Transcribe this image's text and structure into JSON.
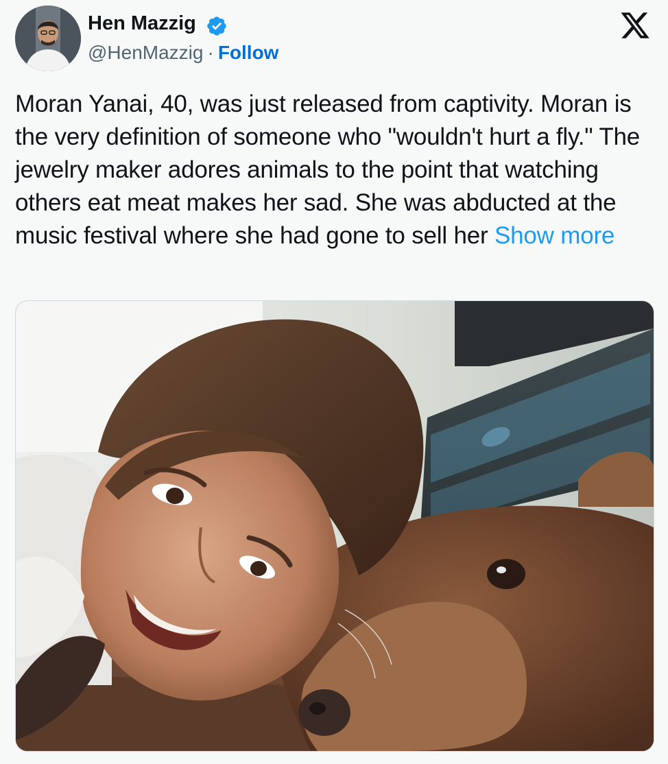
{
  "author": {
    "name": "Hen Mazzig",
    "handle": "@HenMazzig",
    "separator": "·",
    "follow_label": "Follow",
    "verified": true,
    "avatar_icon": "profile-photo"
  },
  "platform": {
    "logo_icon": "x-logo"
  },
  "tweet": {
    "text": "Moran Yanai, 40, was just released from captivity. Moran is the very definition of someone who \"wouldn't hurt a fly.\" The jewelry maker adores animals to the point that watching others eat meat makes her sad. She was abducted at the music festival where she had gone to sell her",
    "show_more_label": "Show more"
  },
  "media": {
    "type": "photo"
  },
  "colors": {
    "link": "#1d9bf0",
    "follow": "#006fd6",
    "verified_badge": "#1d9bf0",
    "text": "#0f1419",
    "secondary_text": "#536471"
  }
}
